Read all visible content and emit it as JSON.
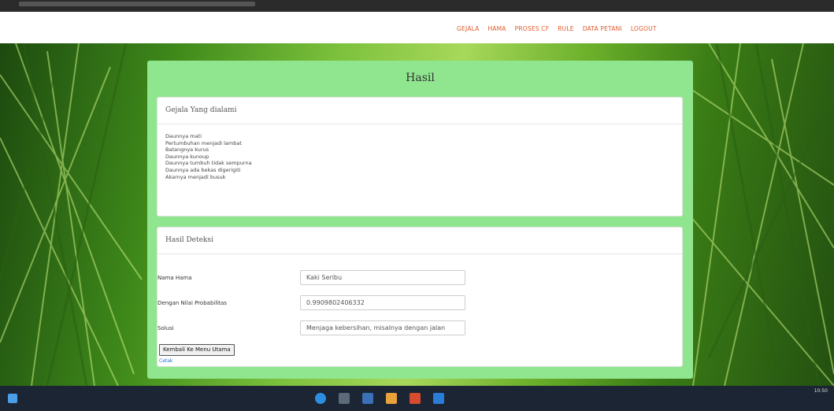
{
  "nav": {
    "items": [
      "GEJALA",
      "HAMA",
      "PROSES CF",
      "RULE",
      "DATA PETANI",
      "LOGOUT"
    ]
  },
  "panel": {
    "title": "Hasil"
  },
  "symptoms_card": {
    "header": "Gejala Yang dialami",
    "items": [
      "Daunnya mati",
      "Pertumbuhan menjadi lambat",
      "Batangnya kurus",
      "Daunnya kunoup",
      "Daunnya tumbuh tidak sempurna",
      "Daunnya ada bekas digerigiti",
      "Akarnya menjadi busuk"
    ]
  },
  "result_card": {
    "header": "Hasil Deteksi",
    "pest_name_label": "Nama Hama",
    "pest_name_value": "Kaki Seribu",
    "probability_label": "Dengan Nilai Probabilitas",
    "probability_value": "0.9909802406332",
    "solution_label": "Solusi",
    "solution_value": "Menjaga kebersihan, misalnya dengan jalan",
    "back_button": "Kembali Ke Menu Utama",
    "print_link": "Cetak"
  },
  "taskbar": {
    "clock_time": "10:50"
  },
  "colors": {
    "panel_bg": "#90e68f",
    "nav_link": "#e05a2a",
    "link": "#1a6fd6"
  }
}
